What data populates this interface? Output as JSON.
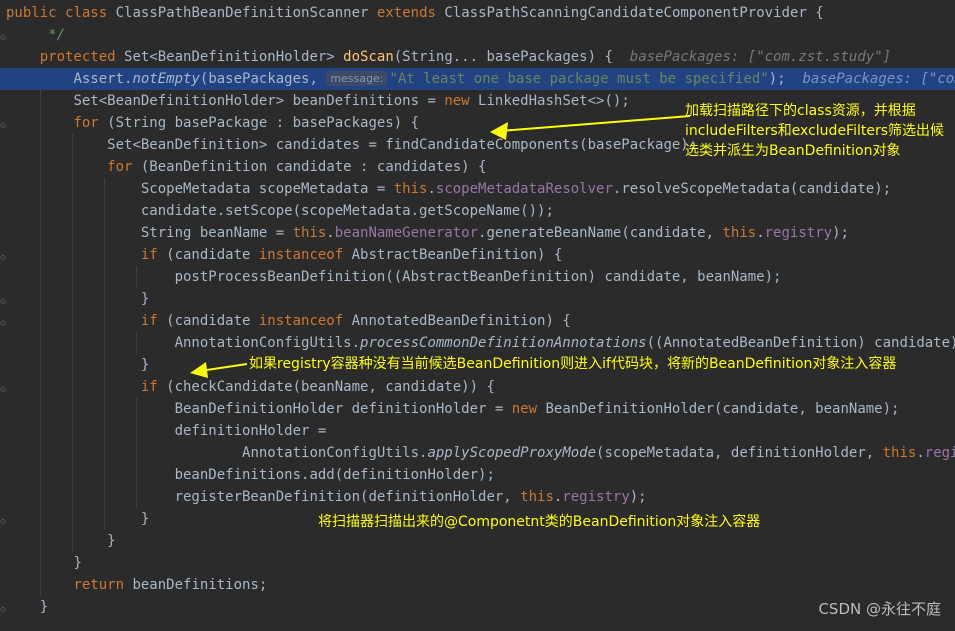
{
  "code": {
    "class_decl": {
      "kw1": "public",
      "kw2": "class",
      "name": "ClassPathBeanDefinitionScanner",
      "kw3": "extends",
      "parent": "ClassPathScanningCandidateComponentProvider",
      "brace": "{"
    },
    "comment_end": "*/",
    "method_sig": {
      "kw": "protected",
      "type": "Set<BeanDefinitionHolder>",
      "name": "doScan",
      "params": "(String... basePackages) {",
      "hint": "basePackages: [\"com.zst.study\"]"
    },
    "assert_line": {
      "pre": "Assert.",
      "call": "notEmpty",
      "mid": "(basePackages, ",
      "tag": "message:",
      "str": "\"At least one base package must be specified\"",
      "end": ");",
      "hint": "basePackages: [\"com.zst"
    },
    "l4": {
      "a": "Set<BeanDefinitionHolder> beanDefinitions = ",
      "kw": "new",
      "b": " LinkedHashSet<>();"
    },
    "l5": {
      "kw": "for",
      "b": " (String basePackage : basePackages) {"
    },
    "l6": "Set<BeanDefinition> candidates = findCandidateComponents(basePackage);",
    "l7": {
      "kw": "for",
      "b": " (BeanDefinition candidate : candidates) {"
    },
    "l8": {
      "a": "ScopeMetadata scopeMetadata = ",
      "kw": "this",
      "dot": ".",
      "fld": "scopeMetadataResolver",
      "b": ".resolveScopeMetadata(candidate);"
    },
    "l9": "candidate.setScope(scopeMetadata.getScopeName());",
    "l10": {
      "a": "String beanName = ",
      "kw": "this",
      "dot": ".",
      "fld": "beanNameGenerator",
      "b": ".generateBeanName(candidate, ",
      "kw2": "this",
      "dot2": ".",
      "fld2": "registry",
      "c": ");"
    },
    "l11": {
      "kw": "if",
      "a": " (candidate ",
      "kw2": "instanceof",
      "b": " AbstractBeanDefinition) {"
    },
    "l12": "postProcessBeanDefinition((AbstractBeanDefinition) candidate, beanName);",
    "l13": "}",
    "l14": {
      "kw": "if",
      "a": " (candidate ",
      "kw2": "instanceof",
      "b": " AnnotatedBeanDefinition) {"
    },
    "l15": {
      "a": "AnnotationConfigUtils.",
      "call": "processCommonDefinitionAnnotations",
      "b": "((AnnotatedBeanDefinition) candidate);"
    },
    "l16": "}",
    "l17": {
      "kw": "if",
      "b": " (checkCandidate(beanName, candidate)) {"
    },
    "l18": {
      "a": "BeanDefinitionHolder definitionHolder = ",
      "kw": "new",
      "b": " BeanDefinitionHolder(candidate, beanName);"
    },
    "l19": "definitionHolder =",
    "l20": {
      "a": "AnnotationConfigUtils.",
      "call": "applyScopedProxyMode",
      "b": "(scopeMetadata, definitionHolder, ",
      "kw": "this",
      "dot": ".",
      "fld": "registry",
      "c": ");"
    },
    "l21": "beanDefinitions.add(definitionHolder);",
    "l22": {
      "a": "registerBeanDefinition(definitionHolder, ",
      "kw": "this",
      "dot": ".",
      "fld": "registry",
      "c": ");"
    },
    "l23": "}",
    "l24": "}",
    "l25": "}",
    "l26": {
      "kw": "return",
      "b": " beanDefinitions;"
    },
    "l27": "}"
  },
  "annotations": {
    "a1": [
      "加载扫描路径下的class资源，并根据",
      "includeFilters和excludeFilters筛选出候",
      "选类并派生为BeanDefinition对象"
    ],
    "a2": "如果registry容器种没有当前候选BeanDefinition则进入if代码块，将新的BeanDefinition对象注入容器",
    "a3": "将扫描器扫描出来的@Componetnt类的BeanDefinition对象注入容器",
    "color": "#ffff00"
  },
  "watermark": "CSDN @永往不庭",
  "colors": {
    "background": "#2b2b2b",
    "highlight": "#214283",
    "keyword": "#cc7832",
    "method": "#ffc66d",
    "string": "#6a8759",
    "field": "#9876aa",
    "text": "#a9b7c6"
  }
}
